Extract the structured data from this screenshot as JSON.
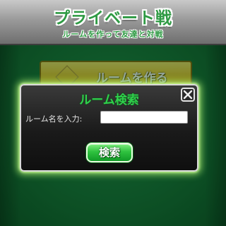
{
  "header": {
    "title": "プライベート戦",
    "subtitle": "ルームを作って友達と対戦"
  },
  "background": {
    "create_room_label": "ルームを作る"
  },
  "dialog": {
    "title": "ルーム検索",
    "room_name_label": "ルーム名を入力:",
    "room_name_value": "",
    "search_button_label": "検索"
  },
  "colors": {
    "felt": "#157a3a",
    "title_green": "#2e9a43",
    "dialog_glow": "#baff78",
    "button_green": "#2fc23f",
    "create_button_yellow": "#e9c623"
  },
  "icons": {
    "close": "close-icon",
    "create_room": "room-icon"
  }
}
